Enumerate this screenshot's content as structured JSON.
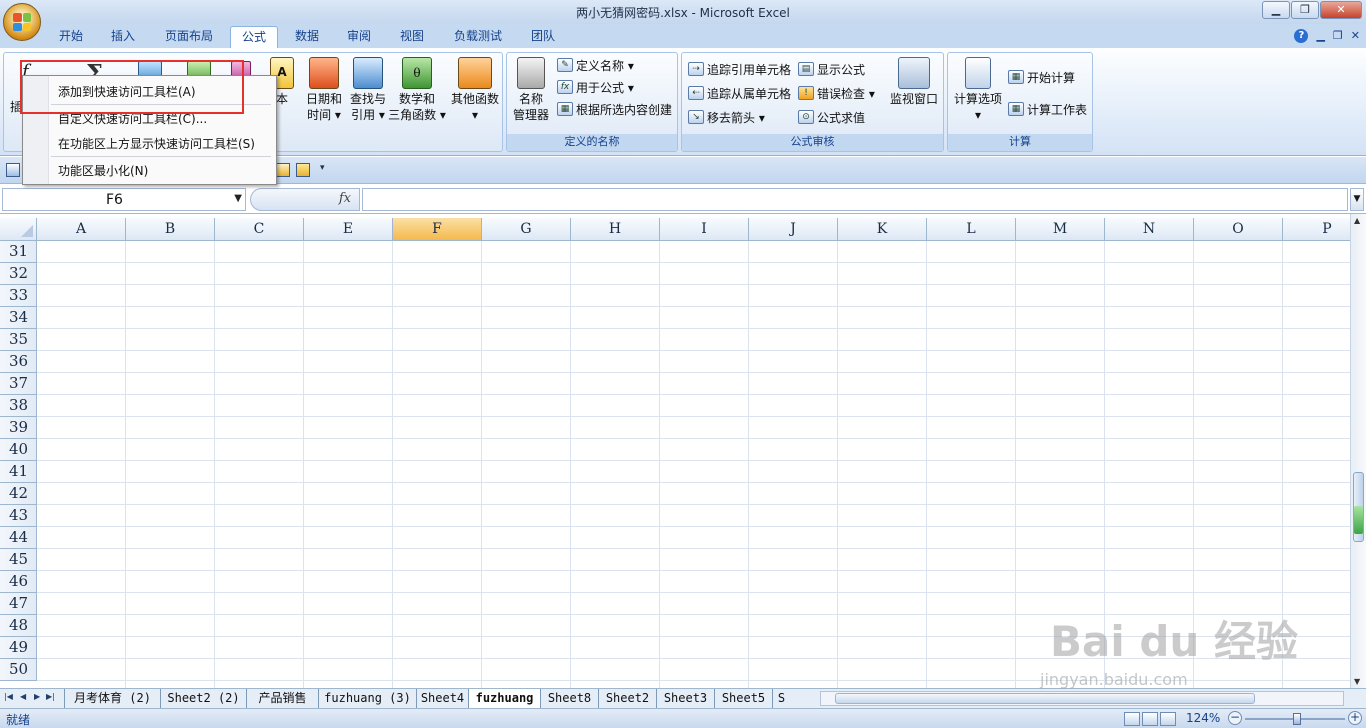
{
  "window": {
    "title": "两小无猜网密码.xlsx - Microsoft Excel"
  },
  "ribbon_tabs": [
    "开始",
    "插入",
    "页面布局",
    "公式",
    "数据",
    "审阅",
    "视图",
    "负载测试",
    "团队"
  ],
  "ribbon": {
    "function_library": {
      "insert_fn_partial": "插",
      "text": "本",
      "datetime": [
        "日期和",
        "时间 ▾"
      ],
      "lookup": [
        "查找与",
        "引用 ▾"
      ],
      "math": [
        "数学和",
        "三角函数 ▾"
      ],
      "other": [
        "其他函数",
        "▾"
      ]
    },
    "defined_names": {
      "label": "定义的名称",
      "name_manager": [
        "名称",
        "管理器"
      ],
      "define_name": "定义名称 ▾",
      "use_in_formula": "用于公式 ▾",
      "create_from_selection": "根据所选内容创建"
    },
    "formula_auditing": {
      "label": "公式审核",
      "trace_precedents": "追踪引用单元格",
      "trace_dependents": "追踪从属单元格",
      "remove_arrows": "移去箭头 ▾",
      "show_formulas": "显示公式",
      "error_checking": "错误检查 ▾",
      "evaluate": "公式求值",
      "watch_window": "监视窗口"
    },
    "calculation": {
      "label": "计算",
      "options": [
        "计算选项",
        "▾"
      ],
      "calc_now": "开始计算",
      "calc_sheet": "计算工作表"
    }
  },
  "context_menu": {
    "items": [
      "添加到快速访问工具栏(A)",
      "自定义快速访问工具栏(C)...",
      "在功能区上方显示快速访问工具栏(S)",
      "功能区最小化(N)"
    ]
  },
  "formula_bar": {
    "name_box": "F6",
    "fx": "fx"
  },
  "columns": [
    "A",
    "B",
    "C",
    "E",
    "F",
    "G",
    "H",
    "I",
    "J",
    "K",
    "L",
    "M",
    "N",
    "O",
    "P"
  ],
  "selected_column": "F",
  "rows": [
    "31",
    "32",
    "33",
    "34",
    "35",
    "36",
    "37",
    "38",
    "39",
    "40",
    "41",
    "42",
    "43",
    "44",
    "45",
    "46",
    "47",
    "48",
    "49",
    "50"
  ],
  "sheets": [
    "月考体育 (2)",
    "Sheet2 (2)",
    "产品销售",
    "fuzhuang (3)",
    "Sheet4",
    "fuzhuang",
    "Sheet8",
    "Sheet2",
    "Sheet3",
    "Sheet5",
    "S"
  ],
  "active_sheet": "fuzhuang",
  "status": {
    "ready": "就绪",
    "zoom": "124%"
  },
  "watermark": {
    "brand": "Bai du 经验",
    "url": "jingyan.baidu.com"
  }
}
